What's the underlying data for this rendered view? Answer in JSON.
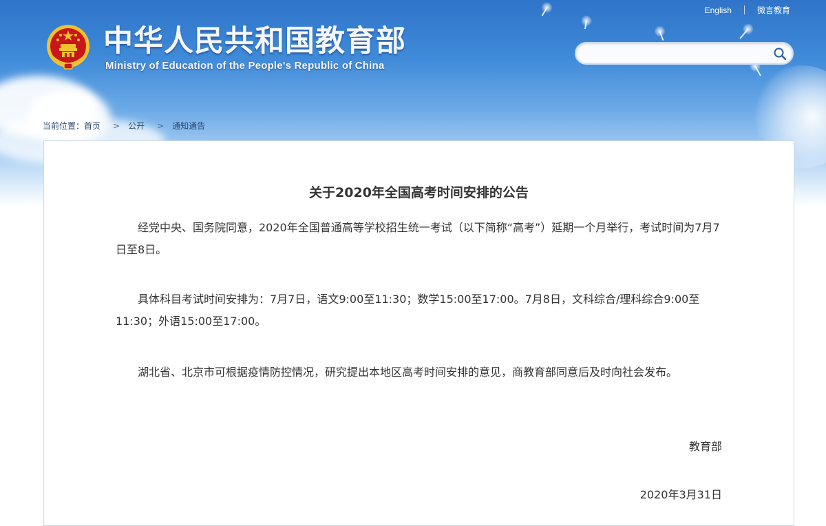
{
  "header": {
    "title_cn": "中华人民共和国教育部",
    "title_en": "Ministry of Education of the People's Republic of China",
    "links": [
      "English",
      "微言教育"
    ]
  },
  "search": {
    "placeholder": "",
    "icon": "search-icon"
  },
  "breadcrumb": {
    "label": "当前位置：",
    "items": [
      "首页",
      "公开",
      "通知通告"
    ]
  },
  "article": {
    "title": "关于2020年全国高考时间安排的公告",
    "paragraphs": [
      "经党中央、国务院同意，2020年全国普通高等学校招生统一考试（以下简称“高考”）延期一个月举行，考试时间为7月7日至8日。",
      "具体科目考试时间安排为：7月7日，语文9:00至11:30；数学15:00至17:00。7月8日，文科综合/理科综合9:00至11:30；外语15:00至17:00。",
      "湖北省、北京市可根据疫情防控情况，研究提出本地区高考时间安排的意见，商教育部同意后及时向社会发布。"
    ],
    "signature": "教育部",
    "date": "2020年3月31日"
  },
  "colors": {
    "sky_top": "#2f74c9",
    "text": "#333333",
    "emblem_red": "#c8161d",
    "emblem_gold": "#f2c12e"
  }
}
